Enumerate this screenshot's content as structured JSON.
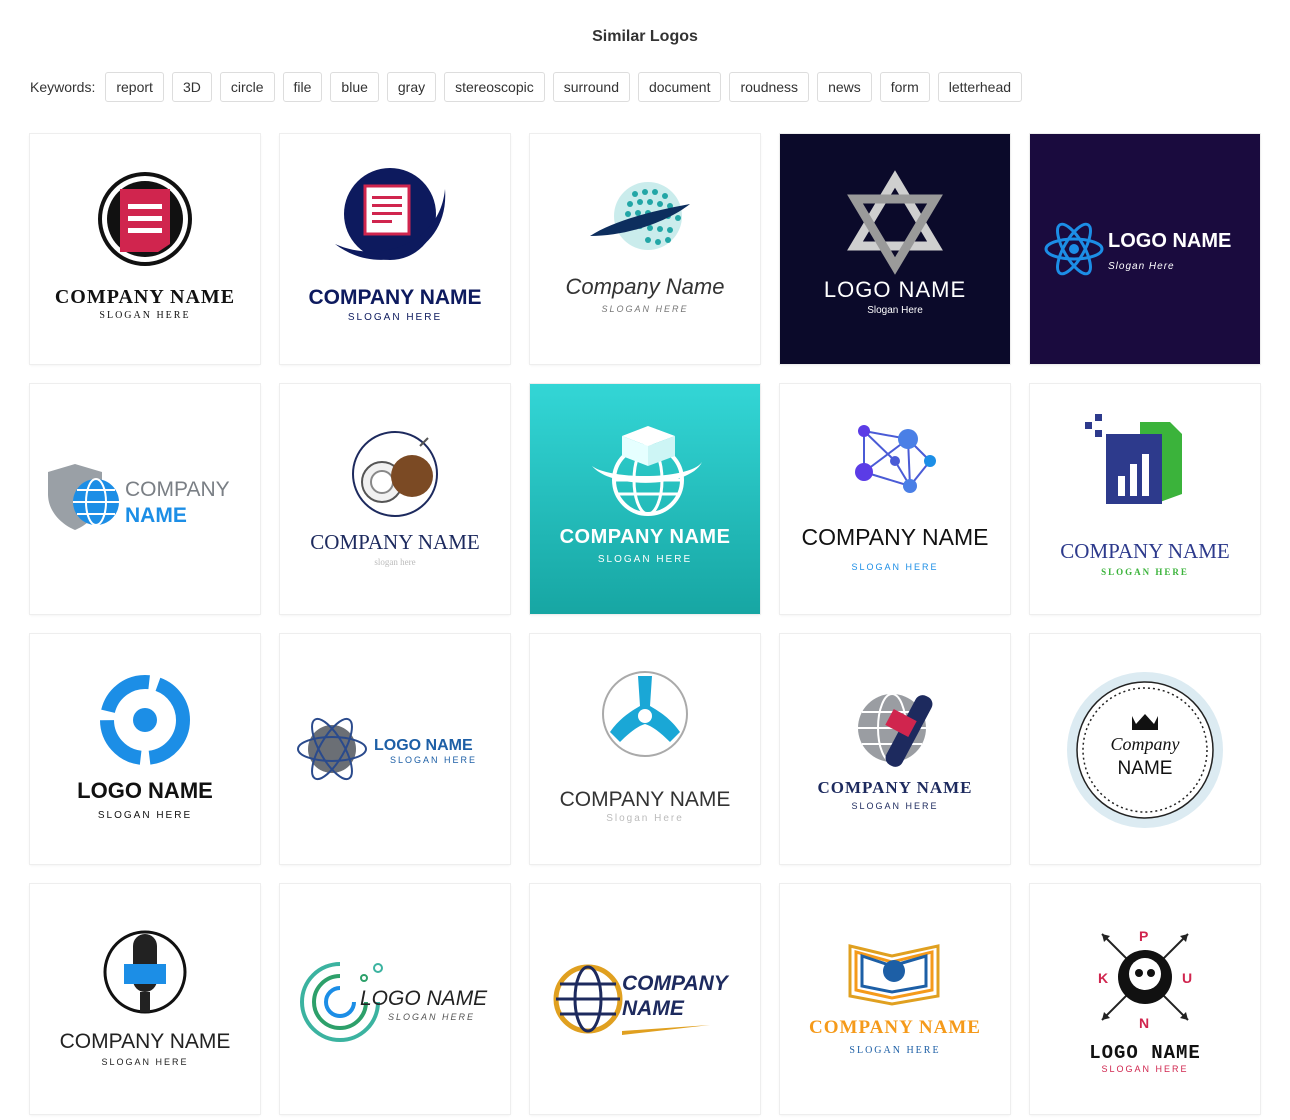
{
  "page": {
    "title": "Similar Logos"
  },
  "keywords": {
    "label": "Keywords:",
    "items": [
      "report",
      "3D",
      "circle",
      "file",
      "blue",
      "gray",
      "stereoscopic",
      "surround",
      "document",
      "roudness",
      "news",
      "form",
      "letterhead"
    ]
  },
  "logos": [
    {
      "name": "COMPANY NAME",
      "slogan": "SLOGAN HERE"
    },
    {
      "name": "COMPANY NAME",
      "slogan": "SLOGAN HERE"
    },
    {
      "name": "Company Name",
      "slogan": "SLOGAN HERE"
    },
    {
      "name": "LOGO NAME",
      "slogan": "Slogan Here"
    },
    {
      "name": "LOGO NAME",
      "slogan": "Slogan Here"
    },
    {
      "name": "COMPANY",
      "name2": "NAME"
    },
    {
      "name": "COMPANY NAME",
      "slogan": "slogan here"
    },
    {
      "name": "COMPANY NAME",
      "slogan": "SLOGAN HERE"
    },
    {
      "name": "COMPANY NAME",
      "slogan": "SLOGAN HERE"
    },
    {
      "name": "COMPANY NAME",
      "slogan": "SLOGAN HERE"
    },
    {
      "name": "LOGO NAME",
      "slogan": "SLOGAN HERE"
    },
    {
      "name": "LOGO NAME",
      "slogan": "SLOGAN HERE"
    },
    {
      "name": "COMPANY NAME",
      "slogan": "Slogan Here"
    },
    {
      "name": "COMPANY NAME",
      "slogan": "SLOGAN HERE"
    },
    {
      "name": "Company",
      "name2": "NAME"
    },
    {
      "name": "COMPANY NAME",
      "slogan": "SLOGAN HERE"
    },
    {
      "name": "LOGO NAME",
      "slogan": "SLOGAN HERE"
    },
    {
      "name": "COMPANY",
      "name2": "NAME"
    },
    {
      "name": "COMPANY NAME",
      "slogan": "SLOGAN HERE"
    },
    {
      "name": "LOGO NAME",
      "slogan": "SLOGAN HERE",
      "letters": [
        "P",
        "K",
        "U",
        "N"
      ]
    }
  ],
  "colors": {
    "navy": "#0b0a2a",
    "purple": "#1a0b3e",
    "teal": "#22bfbf",
    "accent_blue": "#1c8ee6",
    "crimson": "#d0254e"
  }
}
